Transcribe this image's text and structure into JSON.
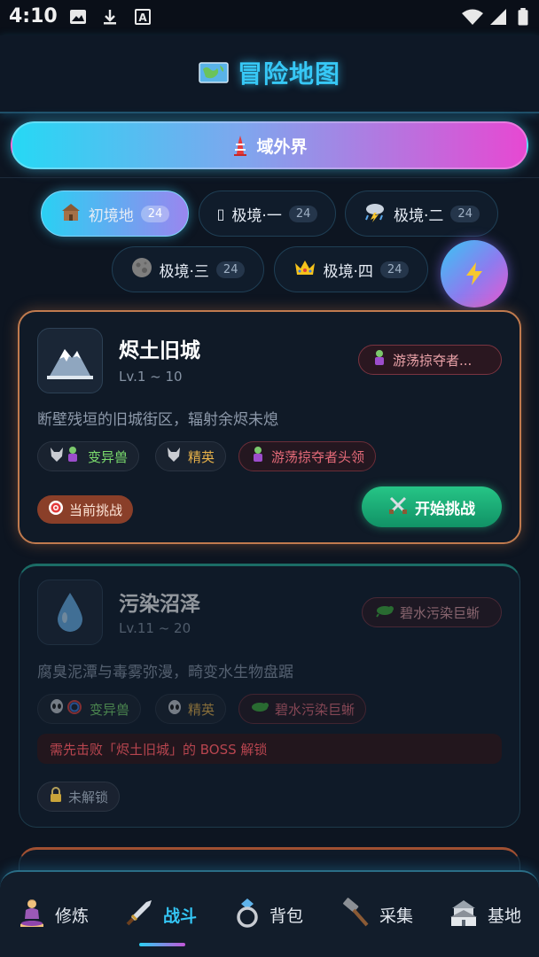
{
  "status_bar": {
    "time": "4:10",
    "left_icons": [
      "image-icon",
      "download-icon",
      "text-a-icon"
    ],
    "right_icons": [
      "wifi-icon",
      "signal-icon",
      "battery-icon"
    ]
  },
  "header": {
    "icon": "map-icon",
    "title": "冒险地图"
  },
  "realm": {
    "icon": "tower-icon",
    "label": "域外界"
  },
  "tiers": [
    {
      "icon": "house-icon",
      "glyph": "🏚",
      "label": "初境地",
      "count": "24",
      "active": true
    },
    {
      "icon": "unknown-glyph-icon",
      "glyph": "▯",
      "label": "极境·一",
      "count": "24",
      "active": false
    },
    {
      "icon": "storm-icon",
      "glyph": "⛈",
      "label": "极境·二",
      "count": "24",
      "active": false
    },
    {
      "icon": "moon-icon",
      "glyph": "●",
      "label": "极境·三",
      "count": "24",
      "active": false
    },
    {
      "icon": "crown-icon",
      "glyph": "♛",
      "label": "极境·四",
      "count": "24",
      "active": false
    }
  ],
  "fab": {
    "icon": "lightning-icon"
  },
  "cards": [
    {
      "icon": "snow-mountain-icon",
      "name": "烬土旧城",
      "level": "Lv.1 ~ 10",
      "boss": "游荡掠夺者...",
      "boss_icon": "zombie-icon",
      "description": "断壁残垣的旧城街区，辐射余烬未熄",
      "tags": [
        {
          "icon": "wolf-zombie-icon",
          "label": "变异兽",
          "color": "green"
        },
        {
          "icon": "wolf-icon",
          "label": "精英",
          "color": "gold"
        },
        {
          "icon": "zombie-icon",
          "label": "游荡掠夺者头领",
          "color": "red"
        }
      ],
      "status": "当前挑战",
      "status_icon": "target-icon",
      "action": "开始挑战",
      "action_icon": "crossed-swords-icon"
    },
    {
      "icon": "water-drop-icon",
      "name": "污染沼泽",
      "level": "Lv.11 ~ 20",
      "boss": "碧水污染巨蜥",
      "boss_icon": "lizard-icon",
      "description": "腐臭泥潭与毒雾弥漫，畸变水生物盘踞",
      "tags": [
        {
          "icon": "alien-rainbow-icon",
          "label": "变异兽",
          "color": "green"
        },
        {
          "icon": "alien-icon",
          "label": "精英",
          "color": "gold"
        },
        {
          "icon": "lizard-icon",
          "label": "碧水污染巨蜥",
          "color": "red"
        }
      ],
      "lock_message": "需先击败「烬土旧城」的 BOSS 解锁",
      "status": "未解锁",
      "status_icon": "lock-icon"
    }
  ],
  "nav": [
    {
      "icon": "meditation-icon",
      "label": "修炼",
      "active": false
    },
    {
      "icon": "dagger-icon",
      "label": "战斗",
      "active": true
    },
    {
      "icon": "ring-icon",
      "label": "背包",
      "active": false
    },
    {
      "icon": "hammer-icon",
      "label": "采集",
      "active": false
    },
    {
      "icon": "castle-icon",
      "label": "基地",
      "active": false
    }
  ],
  "colors": {
    "background": "#0d1521",
    "accent_cyan": "#37c8f6",
    "accent_pink": "#e748d2",
    "active_card_border": "#c07a4e",
    "start_button": "#1bb378"
  }
}
